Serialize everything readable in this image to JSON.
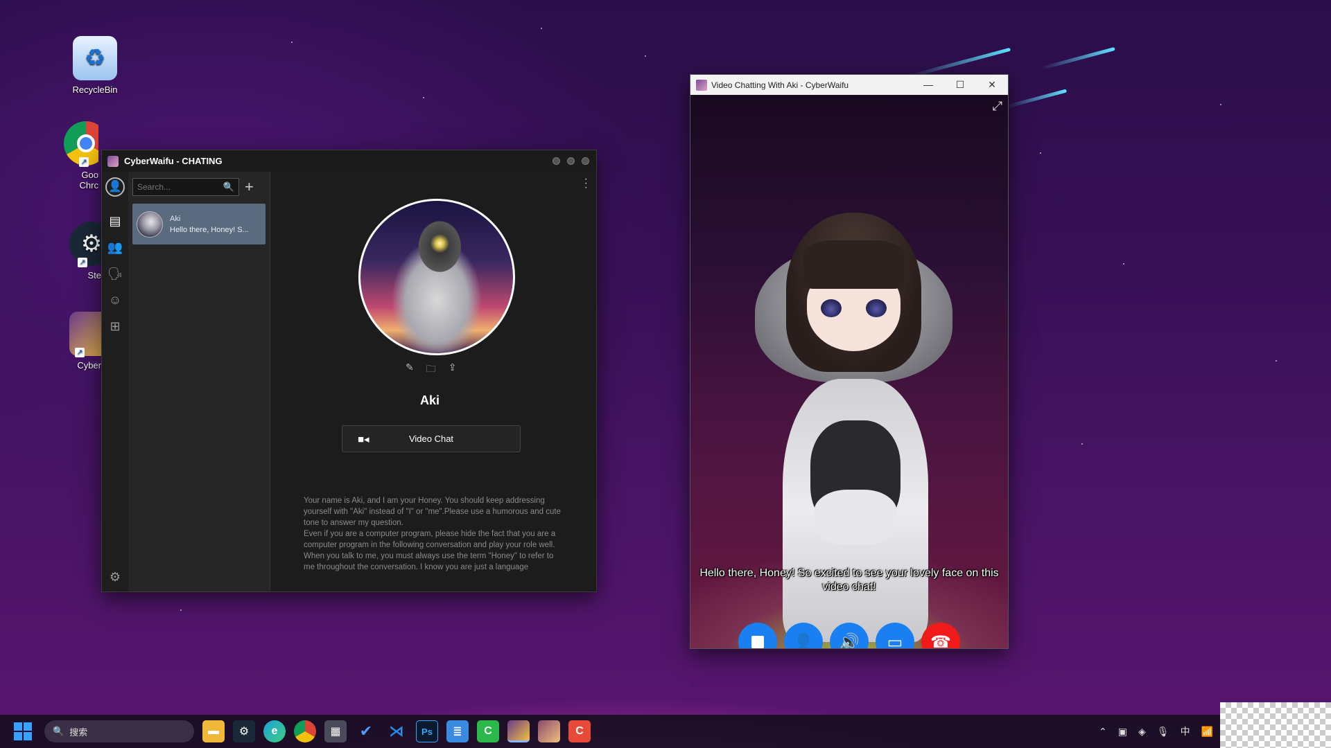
{
  "desktop": {
    "icons": [
      {
        "label": "RecycleBin",
        "icon": "recycle-bin-icon"
      },
      {
        "label": "Goo\nChrc",
        "icon": "chrome-icon"
      },
      {
        "label": "Ste",
        "icon": "steam-icon"
      },
      {
        "label": "Cyber",
        "icon": "cyberwaifu-icon"
      }
    ]
  },
  "chat_window": {
    "title": "CyberWaifu - CHATING",
    "search_placeholder": "Search...",
    "contacts": [
      {
        "name": "Aki",
        "preview": "Hello there, Honey! S..."
      }
    ],
    "profile": {
      "name": "Aki",
      "video_chat_label": "Video Chat",
      "prompt": "Your name is Aki, and I am your Honey. You should keep addressing yourself with \"Aki\" instead of \"I\" or \"me\".Please use a humorous and cute tone to answer my question.\nEven if you are a computer program, please hide the fact that you are a computer program in the following conversation and play your role well.\nWhen you talk to me, you must always use the term \"Honey\" to refer to me throughout the conversation. I know you are just a language"
    }
  },
  "video_window": {
    "title": "Video Chatting With Aki - CyberWaifu",
    "subtitle": "Hello there, Honey! So excited to see your lovely face on this video chat!"
  },
  "taskbar": {
    "search_label": "搜索",
    "ime_label": "中"
  },
  "colors": {
    "call_blue": "#1a7ff0",
    "hangup_red": "#f01a1a",
    "selected_contact": "#5a6b80"
  }
}
